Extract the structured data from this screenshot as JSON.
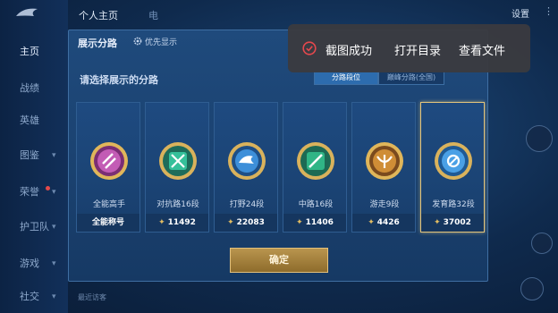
{
  "sidebar": {
    "items": [
      {
        "label": "主页",
        "active": true
      },
      {
        "label": "战绩"
      },
      {
        "label": "英雄"
      },
      {
        "label": "图鉴"
      },
      {
        "label": "荣誉"
      },
      {
        "label": "护卫队"
      },
      {
        "label": "游戏"
      },
      {
        "label": "社交"
      }
    ]
  },
  "topbar": {
    "tabs": [
      "个人主页",
      "电"
    ],
    "settings": "设置"
  },
  "dialog": {
    "title": "展示分路",
    "priority": "优先显示",
    "subtitle": "请选择展示的分路",
    "segments": [
      "分路段位",
      "巅峰分路(全国)"
    ],
    "cards": [
      {
        "name": "全能高手",
        "value": "全能称号",
        "color": "#b6409a",
        "has_score_icon": false
      },
      {
        "name": "对抗路16段",
        "value": "11492",
        "color": "#2fa47a",
        "has_score_icon": true
      },
      {
        "name": "打野24段",
        "value": "22083",
        "color": "#2f86c9",
        "has_score_icon": true
      },
      {
        "name": "中路16段",
        "value": "11406",
        "color": "#2aa36c",
        "has_score_icon": true
      },
      {
        "name": "游走9段",
        "value": "4426",
        "color": "#c98a2f",
        "has_score_icon": true
      },
      {
        "name": "发育路32段",
        "value": "37002",
        "color": "#3a8fd8",
        "has_score_icon": true
      }
    ],
    "confirm": "确定",
    "footer": "最近访客"
  },
  "toast": {
    "message": "截图成功",
    "open_dir": "打开目录",
    "view_file": "查看文件"
  },
  "colors": {
    "accent_gold": "#e3c47b",
    "toast_bg": "#3a3a40",
    "check_red": "#e5484d"
  }
}
